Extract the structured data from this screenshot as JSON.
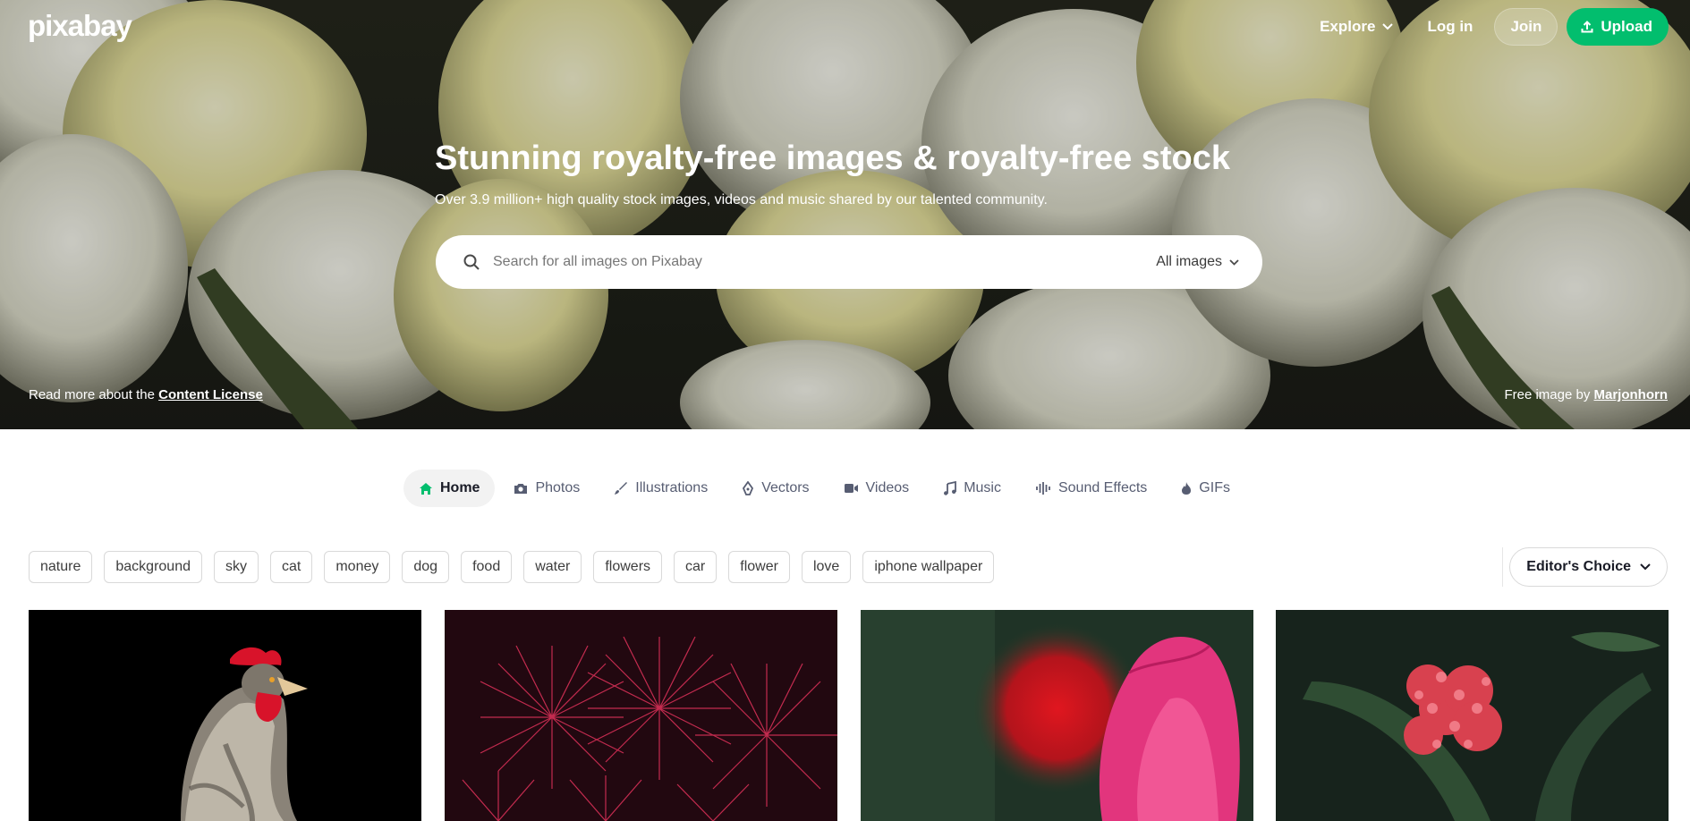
{
  "brand": {
    "logo_text": "pixabay",
    "accent_color": "#02be6e"
  },
  "nav": {
    "explore_label": "Explore",
    "login_label": "Log in",
    "join_label": "Join",
    "upload_label": "Upload"
  },
  "hero": {
    "title": "Stunning royalty-free images & royalty-free stock",
    "subtitle": "Over 3.9 million+ high quality stock images, videos and music shared by our talented community.",
    "license_prefix": "Read more about the",
    "license_link": "Content License",
    "credit_prefix": "Free image by",
    "credit_author": "Marjonhorn"
  },
  "search": {
    "placeholder": "Search for all images on Pixabay",
    "type_label": "All images"
  },
  "tabs": [
    {
      "label": "Home",
      "icon": "home-icon",
      "active": true
    },
    {
      "label": "Photos",
      "icon": "camera-icon"
    },
    {
      "label": "Illustrations",
      "icon": "brush-icon"
    },
    {
      "label": "Vectors",
      "icon": "pen-nib-icon"
    },
    {
      "label": "Videos",
      "icon": "video-camera-icon"
    },
    {
      "label": "Music",
      "icon": "music-note-icon"
    },
    {
      "label": "Sound Effects",
      "icon": "sound-wave-icon"
    },
    {
      "label": "GIFs",
      "icon": "flame-icon"
    }
  ],
  "tags": [
    "nature",
    "background",
    "sky",
    "cat",
    "money",
    "dog",
    "food",
    "water",
    "flowers",
    "car",
    "flower",
    "love",
    "iphone wallpaper"
  ],
  "sort": {
    "label": "Editor's Choice"
  }
}
